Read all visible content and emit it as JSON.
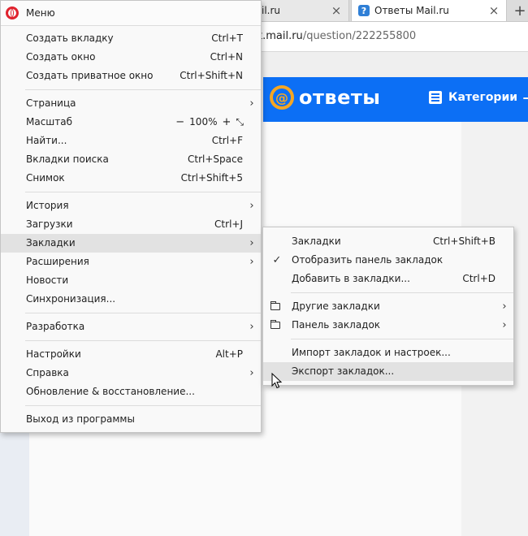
{
  "browser": {
    "tabs": [
      {
        "title": "il.ru",
        "close": "×"
      },
      {
        "title": "Ответы Mail.ru",
        "close": "×",
        "favicon": "?"
      }
    ],
    "new_tab": "+",
    "address": {
      "host": "et.mail.ru",
      "path": "/question/222255800"
    }
  },
  "page": {
    "brand": "ответы",
    "at_symbol": "@",
    "categories_label": "Категории",
    "header_plus": "+",
    "colors": {
      "header_bg": "#0c6ff5",
      "logo_accent": "#f5a623"
    }
  },
  "main_menu": {
    "title": "Меню",
    "groups": [
      [
        {
          "label": "Создать вкладку",
          "shortcut": "Ctrl+T"
        },
        {
          "label": "Создать окно",
          "shortcut": "Ctrl+N"
        },
        {
          "label": "Создать приватное окно",
          "shortcut": "Ctrl+Shift+N"
        }
      ],
      [
        {
          "label": "Страница",
          "arrow": "›"
        },
        {
          "label": "Масштаб",
          "zoom": {
            "minus": "−",
            "value": "100%",
            "plus": "+",
            "fit": "⤡"
          }
        },
        {
          "label": "Найти...",
          "shortcut": "Ctrl+F"
        },
        {
          "label": "Вкладки поиска",
          "shortcut": "Ctrl+Space"
        },
        {
          "label": "Снимок",
          "shortcut": "Ctrl+Shift+5"
        }
      ],
      [
        {
          "label": "История",
          "arrow": "›"
        },
        {
          "label": "Загрузки",
          "shortcut": "Ctrl+J"
        },
        {
          "label": "Закладки",
          "arrow": "›",
          "highlighted": true
        },
        {
          "label": "Расширения",
          "arrow": "›"
        },
        {
          "label": "Новости"
        },
        {
          "label": "Синхронизация..."
        }
      ],
      [
        {
          "label": "Разработка",
          "arrow": "›"
        }
      ],
      [
        {
          "label": "Настройки",
          "shortcut": "Alt+P"
        },
        {
          "label": "Справка",
          "arrow": "›"
        },
        {
          "label": "Обновление & восстановление..."
        }
      ],
      [
        {
          "label": "Выход из программы"
        }
      ]
    ]
  },
  "bookmarks_submenu": {
    "groups": [
      [
        {
          "label": "Закладки",
          "shortcut": "Ctrl+Shift+B"
        },
        {
          "label": "Отобразить панель закладок",
          "check": "✓"
        },
        {
          "label": "Добавить в закладки...",
          "shortcut": "Ctrl+D"
        }
      ],
      [
        {
          "label": "Другие закладки",
          "arrow": "›",
          "icon": "folder-icon"
        },
        {
          "label": "Панель закладок",
          "arrow": "›",
          "icon": "folder-icon"
        }
      ],
      [
        {
          "label": "Импорт закладок и настроек..."
        },
        {
          "label": "Экспорт закладок...",
          "highlighted": true
        }
      ]
    ]
  }
}
